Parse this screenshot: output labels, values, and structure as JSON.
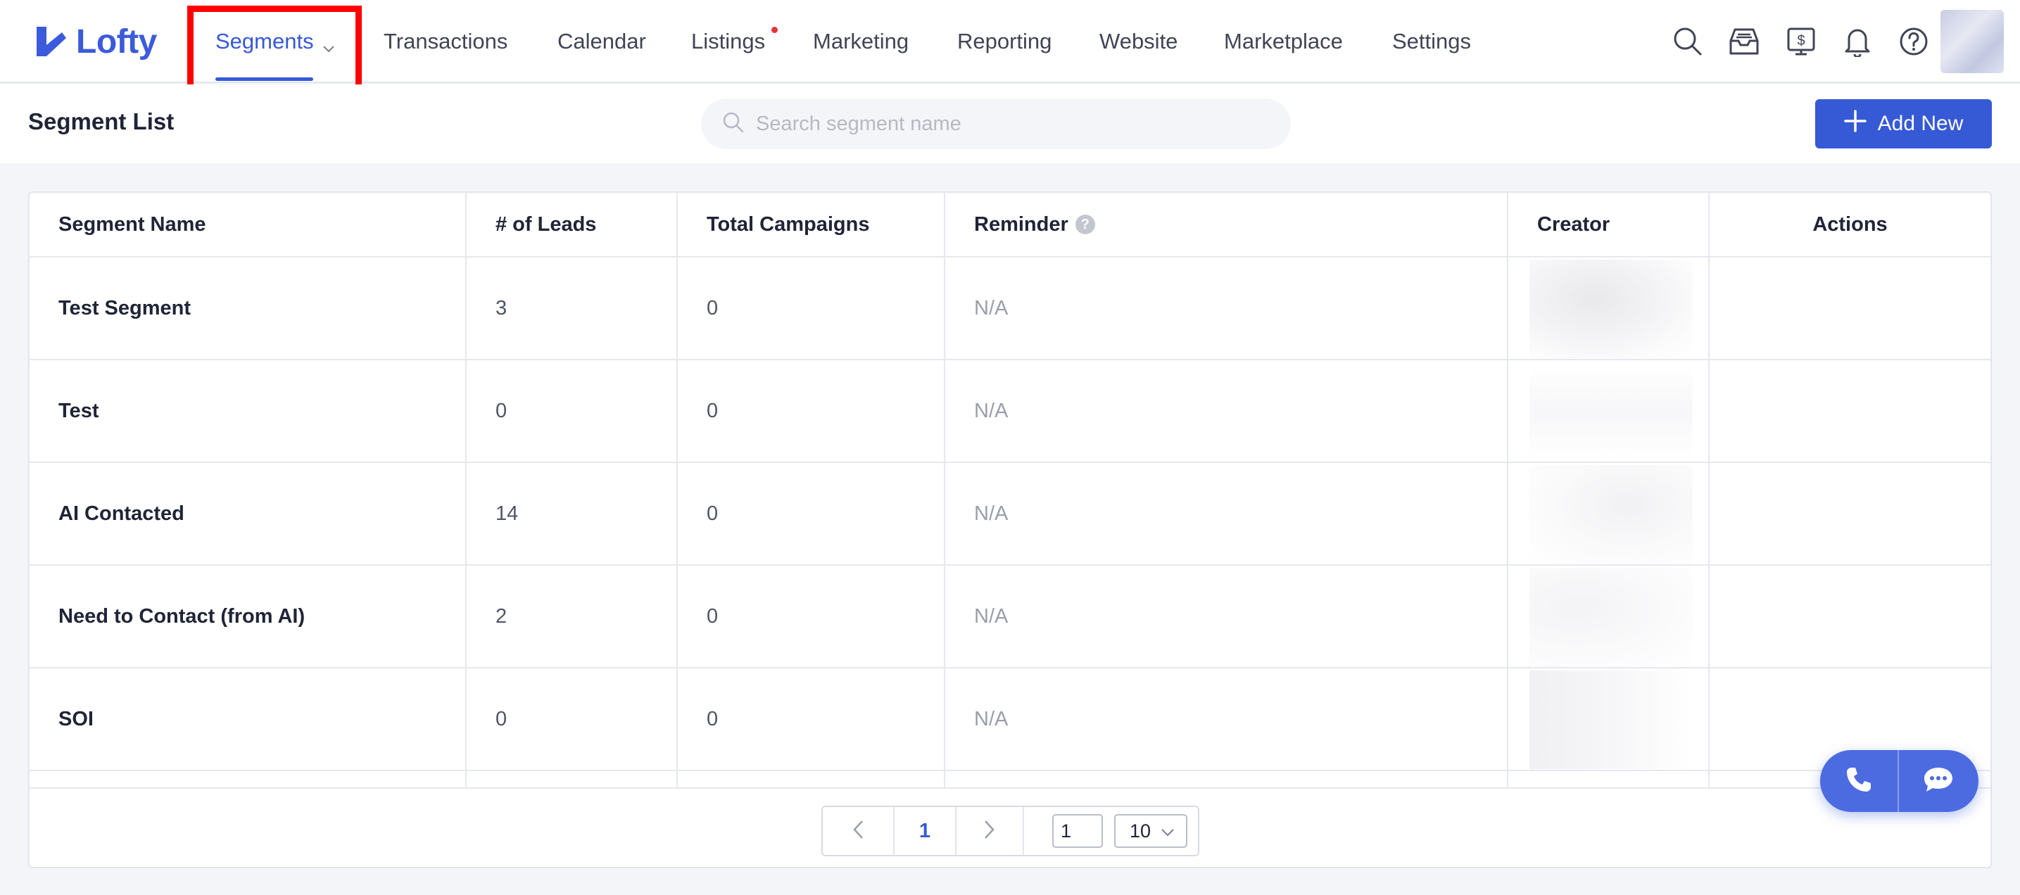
{
  "brand": {
    "name": "Lofty",
    "color": "#3b5bdb"
  },
  "nav": {
    "items": [
      {
        "label": "Segments",
        "active": true,
        "has_dropdown": true
      },
      {
        "label": "Transactions"
      },
      {
        "label": "Calendar"
      },
      {
        "label": "Listings",
        "has_notification_dot": true
      },
      {
        "label": "Marketing"
      },
      {
        "label": "Reporting"
      },
      {
        "label": "Website"
      },
      {
        "label": "Marketplace"
      },
      {
        "label": "Settings"
      }
    ],
    "icons": [
      "search-icon",
      "inbox-icon",
      "billing-icon",
      "bell-icon",
      "help-icon"
    ]
  },
  "page": {
    "title": "Segment List",
    "search_placeholder": "Search segment name",
    "add_button": "Add New"
  },
  "table": {
    "columns": [
      "Segment Name",
      "# of Leads",
      "Total Campaigns",
      "Reminder",
      "Creator",
      "Actions"
    ],
    "rows": [
      {
        "name": "Test Segment",
        "leads": "3",
        "campaigns": "0",
        "reminder": "N/A",
        "actions_enabled": true
      },
      {
        "name": "Test",
        "leads": "0",
        "campaigns": "0",
        "reminder": "N/A",
        "actions_enabled": false
      },
      {
        "name": "AI Contacted",
        "leads": "14",
        "campaigns": "0",
        "reminder": "N/A",
        "actions_enabled": true
      },
      {
        "name": "Need to Contact (from AI)",
        "leads": "2",
        "campaigns": "0",
        "reminder": "N/A",
        "actions_enabled": true
      },
      {
        "name": "SOI",
        "leads": "0",
        "campaigns": "0",
        "reminder": "N/A",
        "actions_enabled": false
      }
    ]
  },
  "pagination": {
    "current_page": "1",
    "jump_value": "1",
    "page_size": "10"
  },
  "colors": {
    "accent": "#3659d6",
    "highlight": "#ff0000",
    "notification": "#e5343b"
  }
}
